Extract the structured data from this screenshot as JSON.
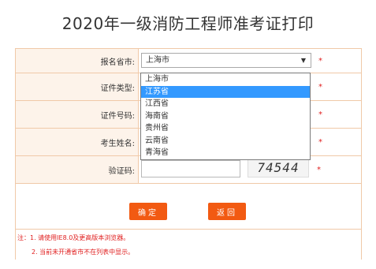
{
  "page": {
    "title": "2020年一级消防工程师准考证打印"
  },
  "form": {
    "province": {
      "label": "报名省市:",
      "value": "上海市",
      "arrow": "▼",
      "required": "*"
    },
    "cert_type": {
      "label": "证件类型:",
      "required": "*"
    },
    "cert_no": {
      "label": "证件号码:",
      "required": "*"
    },
    "name": {
      "label": "考生姓名:",
      "required": "*"
    },
    "captcha": {
      "label": "验证码:",
      "image_text": "74544",
      "required": "*"
    }
  },
  "dropdown": {
    "options": [
      "上海市",
      "江苏省",
      "江西省",
      "海南省",
      "贵州省",
      "云南省",
      "青海省"
    ],
    "highlighted": "江苏省"
  },
  "buttons": {
    "confirm": "确定",
    "back": "返回"
  },
  "notes": {
    "line1": "注：1. 请使用IE8.0及更高版本浏览器。",
    "line2": "2. 当前未开通省市不在列表中显示。"
  },
  "colors": {
    "accent": "#f25a12",
    "required": "#e02020",
    "highlight": "#3399ff",
    "row_bg": "#fdf3ea"
  }
}
